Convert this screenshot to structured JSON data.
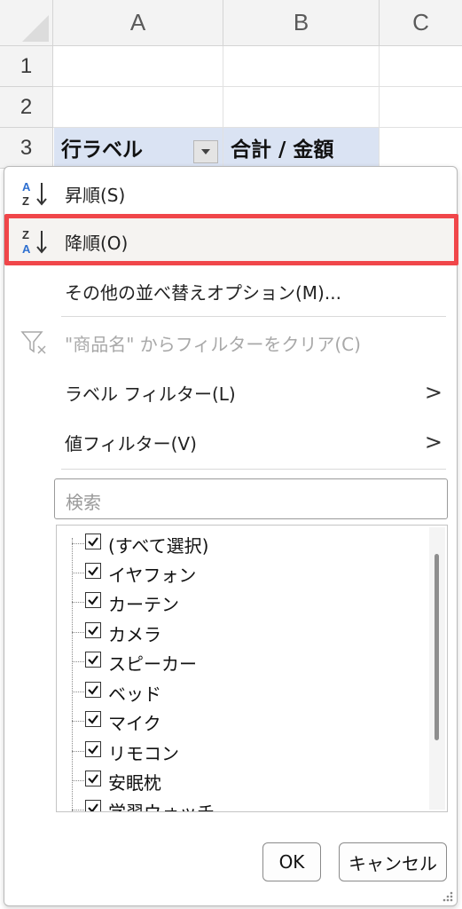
{
  "columns": [
    "A",
    "B",
    "C"
  ],
  "rows": [
    "1",
    "2",
    "3"
  ],
  "pivot": {
    "row_label_header": "行ラベル",
    "value_header": "合計 / 金額"
  },
  "menu": {
    "sort_ascending": "昇順(S)",
    "sort_descending": "降順(O)",
    "more_sort_options": "その他の並べ替えオプション(M)...",
    "clear_filter": "\"商品名\" からフィルターをクリア(C)",
    "label_filter": "ラベル フィルター(L)",
    "value_filter": "値フィルター(V)",
    "submenu_arrow": ">"
  },
  "search": {
    "placeholder": "検索"
  },
  "filter_items": [
    "(すべて選択)",
    "イヤフォン",
    "カーテン",
    "カメラ",
    "スピーカー",
    "ベッド",
    "マイク",
    "リモコン",
    "安眠枕",
    "学習ウォッチ"
  ],
  "buttons": {
    "ok": "OK",
    "cancel": "キャンセル"
  },
  "icons": {
    "sort_ascending": "sort-az-icon",
    "sort_descending": "sort-za-icon",
    "clear_filter": "clear-filter-icon",
    "dropdown": "dropdown-arrow-icon"
  },
  "colors": {
    "highlight_border": "#f0464a",
    "pivot_header_bg": "#dae3f3",
    "sort_icon_blue": "#2e6fd0"
  }
}
